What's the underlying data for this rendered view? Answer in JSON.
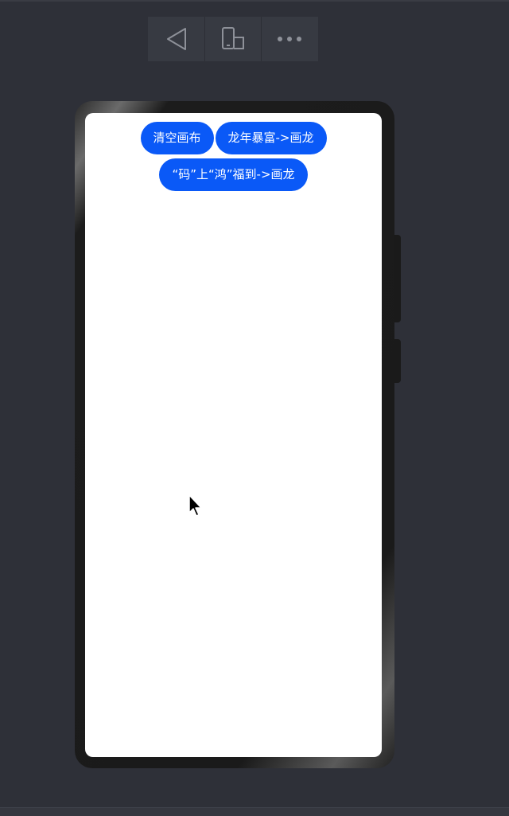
{
  "toolbar": {
    "back_icon": "back-triangle-icon",
    "device_icon": "device-rotate-icon",
    "more_icon": "more-dots-icon"
  },
  "app": {
    "buttons": {
      "clear_canvas": "清空画布",
      "dragon_year": "龙年暴富->画龙",
      "code_harmony": "“码”上“鸿”福到->画龙"
    },
    "accent_color": "#0a59f7"
  }
}
